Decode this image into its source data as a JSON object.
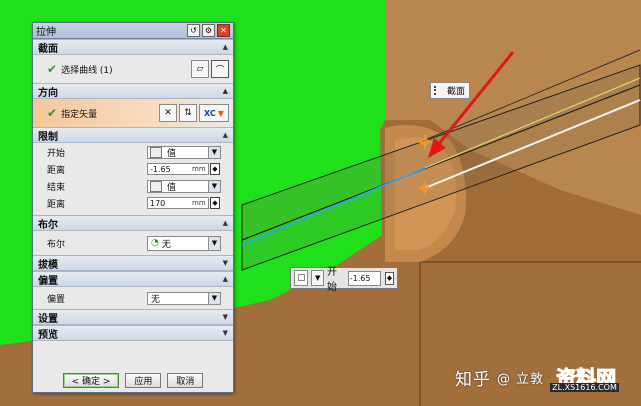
{
  "dialog": {
    "title": "拉伸",
    "sections": {
      "section": {
        "header": "截面",
        "select_curve_label": "选择曲线 (1)"
      },
      "direction": {
        "header": "方向",
        "specify_vector_label": "指定矢量",
        "vector_option": "XC"
      },
      "limits": {
        "header": "限制",
        "start_label": "开始",
        "start_option": "值",
        "start_distance_label": "距离",
        "start_distance_value": "-1.65",
        "start_unit": "mm",
        "end_label": "结束",
        "end_option": "值",
        "end_distance_label": "距离",
        "end_distance_value": "170",
        "end_unit": "mm"
      },
      "boolean": {
        "header": "布尔",
        "boolean_label": "布尔",
        "boolean_value": "无"
      },
      "draft": {
        "header": "拔模"
      },
      "offset": {
        "header": "偏置",
        "offset_label": "偏置",
        "offset_value": "无"
      },
      "settings": {
        "header": "设置"
      },
      "preview": {
        "header": "预览"
      }
    },
    "buttons": {
      "ok": "< 确定 >",
      "apply": "应用",
      "cancel": "取消"
    }
  },
  "viewport": {
    "section_tag": "截面",
    "inline_start_label": "开始",
    "inline_start_value": "-1.65"
  },
  "watermark": {
    "zhihu_text": "知乎",
    "overlay_text": "@ 立敦",
    "logo_text": "资料网",
    "logo_url": "ZL.XS1616.COM"
  },
  "colors": {
    "green_face": "#1fe01a",
    "brown_solid": "#a26f3c",
    "arrow_red": "#e01818",
    "title_bar": "#b4c4d8"
  },
  "icons": [
    "check-icon",
    "curve-select-icon",
    "sketch-icon",
    "vector-dialog-icon",
    "reverse-direction-icon",
    "dropdown-arrow-icon",
    "cube-icon",
    "spin-icon",
    "boolean-none-icon",
    "chevron-up-icon",
    "chevron-down-icon",
    "reset-icon",
    "gear-icon",
    "close-icon"
  ]
}
